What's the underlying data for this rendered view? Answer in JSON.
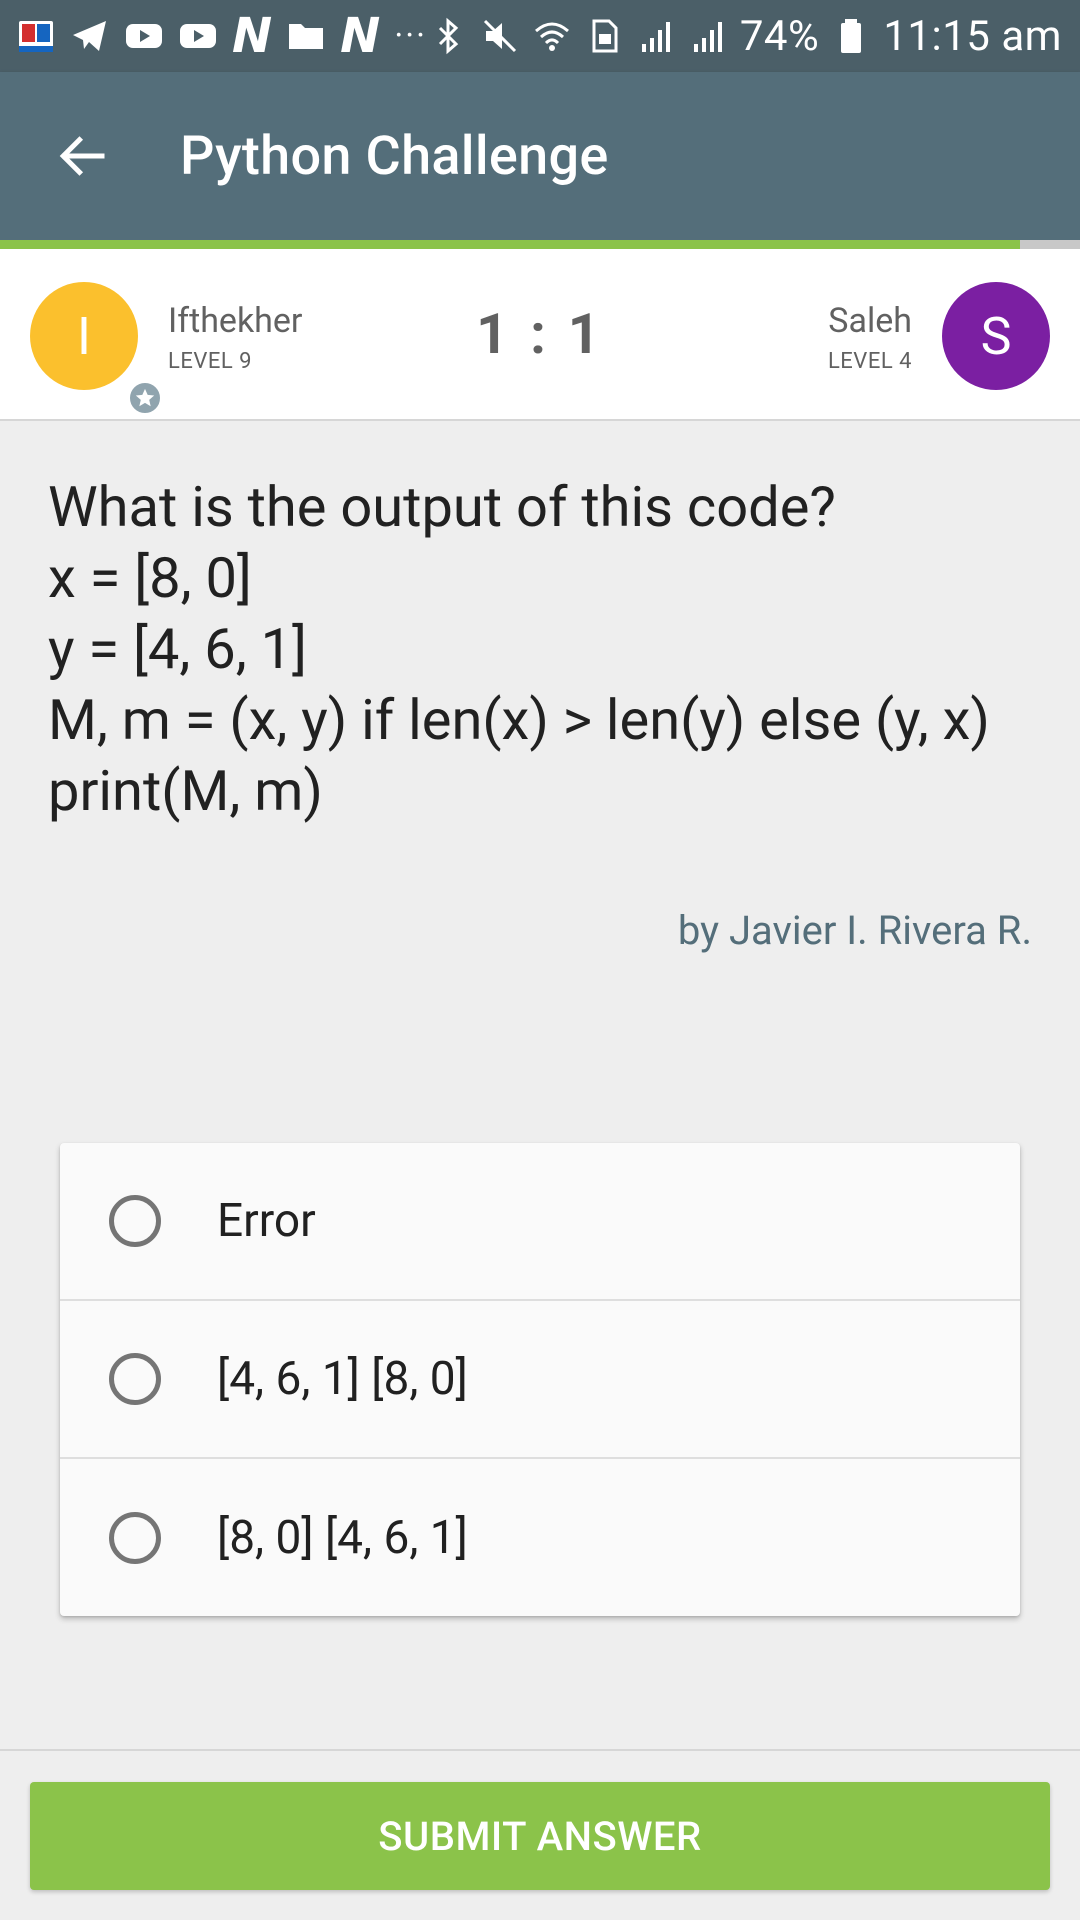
{
  "status_bar": {
    "battery": "74%",
    "time": "11:15 am",
    "dots": "···",
    "n_letter": "N",
    "icons_left": [
      "bangla-dictionary-icon",
      "telegram-icon",
      "youtube-icon",
      "youtube-icon",
      "netflix-n-icon",
      "folder-icon",
      "netflix-n-icon",
      "more-dots-icon"
    ],
    "icons_right": [
      "bluetooth-icon",
      "mute-icon",
      "wifi-icon",
      "sim-icon",
      "signal-icon",
      "signal-icon",
      "battery-icon"
    ]
  },
  "app_bar": {
    "title": "Python Challenge",
    "progress": 0.944,
    "progress_color": "#8bc34a",
    "background": "#546e7a"
  },
  "players": {
    "left": {
      "initial": "I",
      "name": "Ifthekher",
      "level": "LEVEL 9",
      "color": "#fbc02d"
    },
    "right": {
      "initial": "S",
      "name": "Saleh",
      "level": "LEVEL 4",
      "color": "#7b1fa2"
    },
    "score": "1 : 1"
  },
  "question": {
    "text": "What is the output of this code?\nx = [8, 0]\ny = [4, 6, 1]\nM, m = (x, y) if len(x) > len(y) else (y, x)\nprint(M, m)",
    "author": "by Javier I. Rivera R."
  },
  "options": [
    {
      "label": "Error"
    },
    {
      "label": "[4, 6, 1] [8, 0]"
    },
    {
      "label": "[8, 0] [4, 6, 1]"
    }
  ],
  "submit": {
    "label": "SUBMIT ANSWER",
    "color": "#8bc34a"
  }
}
